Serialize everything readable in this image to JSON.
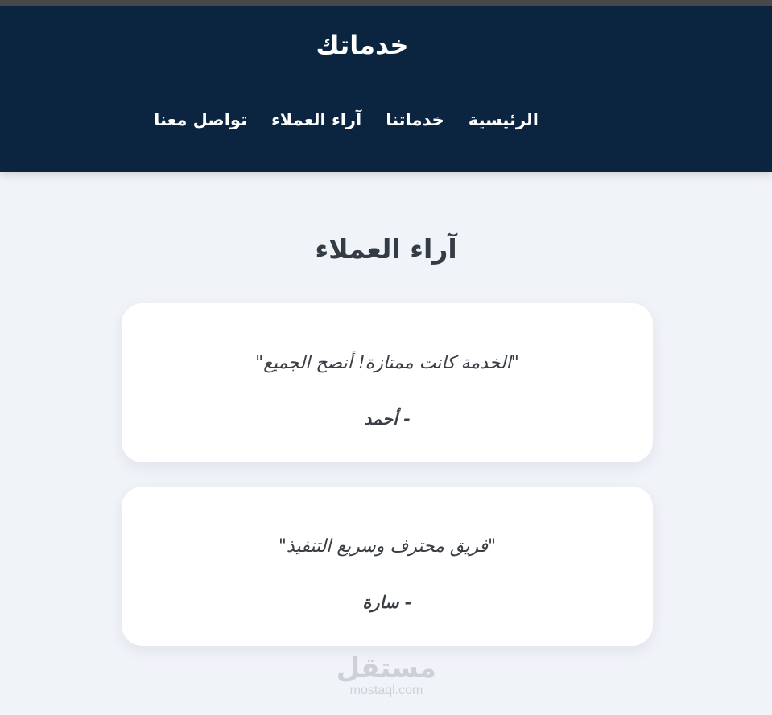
{
  "header": {
    "site_title": "خدماتك",
    "nav": [
      {
        "label": "الرئيسية"
      },
      {
        "label": "خدماتنا"
      },
      {
        "label": "آراء العملاء"
      },
      {
        "label": "تواصل معنا"
      }
    ]
  },
  "testimonials": {
    "title": "آراء العملاء",
    "items": [
      {
        "quote": "\"الخدمة كانت ممتازة! أنصح الجميع\"",
        "author": "- أحمد"
      },
      {
        "quote": "\"فريق محترف وسريع التنفيذ\"",
        "author": "- سارة"
      }
    ]
  },
  "watermark": {
    "arabic": "مستقل",
    "latin": "mostaql.com"
  },
  "colors": {
    "header_bg": "#0b2440",
    "page_bg": "#f0f3f8",
    "card_bg": "#ffffff"
  }
}
